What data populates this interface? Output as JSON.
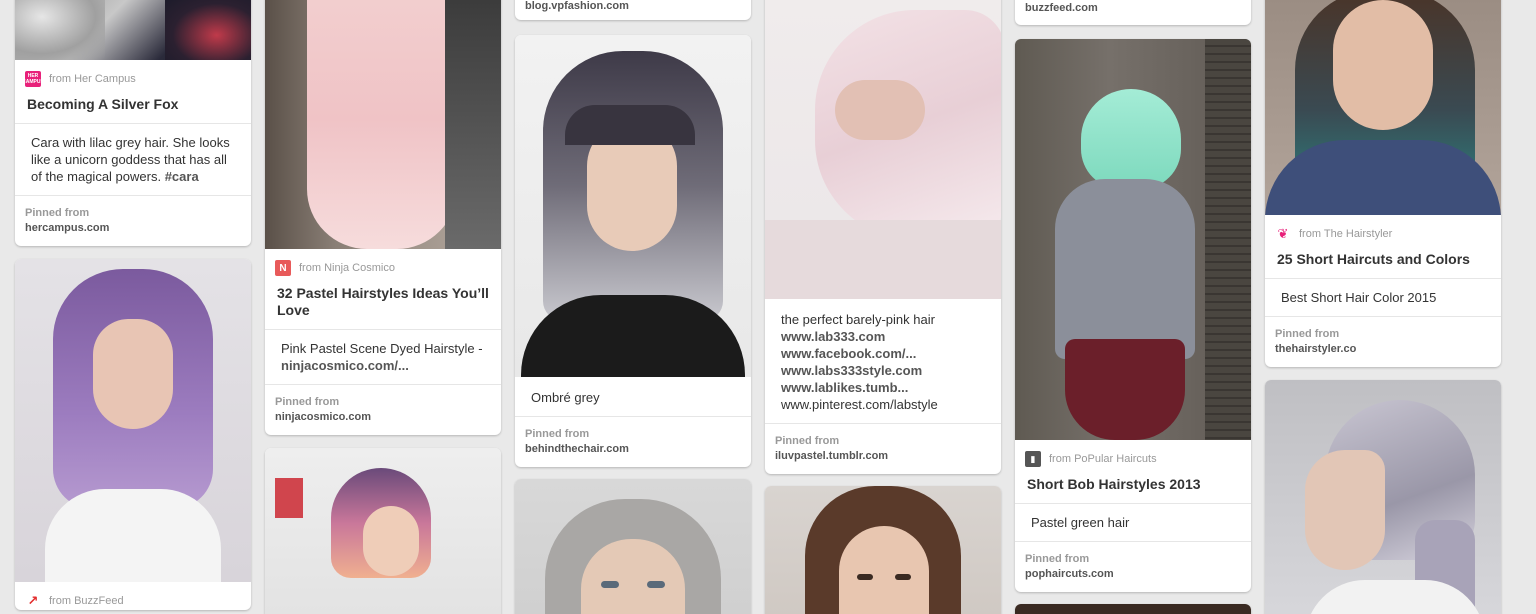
{
  "pins": {
    "silver_fox": {
      "source_prefix": "from",
      "source_name": "Her Campus",
      "title": "Becoming A Silver Fox",
      "desc": "Cara with lilac grey hair. She looks like a unicorn goddess that has all of the magical powers.",
      "hashtag": "#cara",
      "pinned_label": "Pinned from",
      "domain": "hercampus.com",
      "icon_text": "HER CAMPUS",
      "icon_color": "#e8217a"
    },
    "purple_bob": {
      "source_prefix": "from",
      "source_name": "BuzzFeed",
      "icon_color": "#e32c2c"
    },
    "pastel_32": {
      "source_prefix": "from",
      "source_name": "Ninja Cosmico",
      "title": "32 Pastel Hairstyles Ideas You’ll Love",
      "desc": "Pink Pastel Scene Dyed Hairstyle -",
      "link": "ninjacosmico.com/...",
      "pinned_label": "Pinned from",
      "domain": "ninjacosmico.com",
      "icon_text": "N",
      "icon_color": "#e85a5a"
    },
    "vpfashion": {
      "domain": "blog.vpfashion.com"
    },
    "ombre": {
      "desc": "Ombré grey",
      "pinned_label": "Pinned from",
      "domain": "behindthechair.com"
    },
    "barely_pink": {
      "desc": "the perfect barely-pink hair",
      "links": [
        "www.lab333.com",
        "www.facebook.com/...",
        "www.labs333style.com",
        "www.lablikes.tumb...",
        "www.pinterest.com/labstyle"
      ],
      "pinned_label": "Pinned from",
      "domain": "iluvpastel.tumblr.com"
    },
    "buzzfeed_top": {
      "domain": "buzzfeed.com"
    },
    "short_bob": {
      "source_prefix": "from",
      "source_name": "PoPular Haircuts",
      "title": "Short Bob Hairstyles 2013",
      "desc": "Pastel green hair",
      "pinned_label": "Pinned from",
      "domain": "pophaircuts.com",
      "icon_color": "#555555"
    },
    "short_25": {
      "source_prefix": "from",
      "source_name": "The Hairstyler",
      "title": "25 Short Haircuts and Colors",
      "desc": "Best Short Hair Color 2015",
      "pinned_label": "Pinned from",
      "domain": "thehairstyler.co",
      "icon_color": "#e8217a"
    }
  },
  "colors": {
    "background": "#e9e9e9",
    "card": "#ffffff",
    "muted": "#999999",
    "text": "#333333"
  }
}
